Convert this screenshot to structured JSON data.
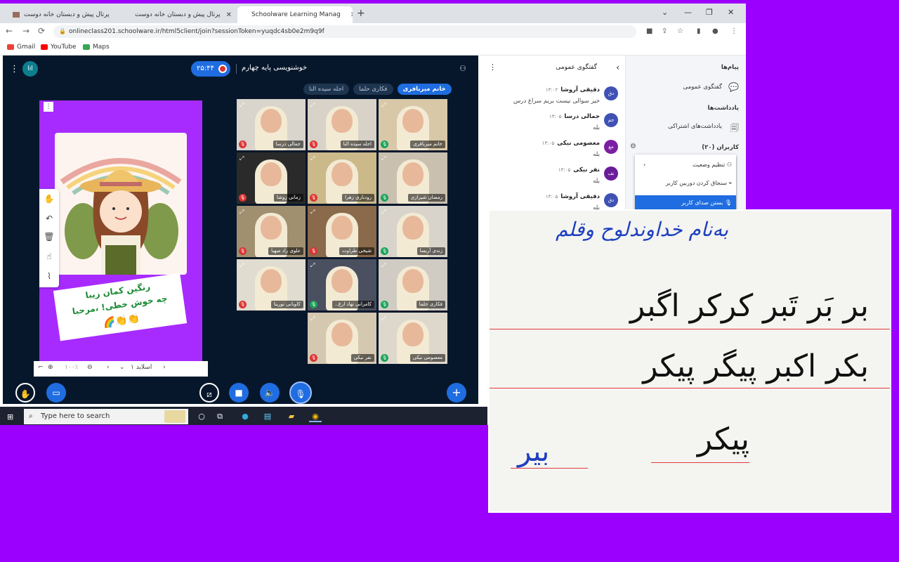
{
  "tabs": [
    {
      "title": "پرتال پیش و دبستان خانه دوست"
    },
    {
      "title": "پرتال پیش و دبستان خانه دوست"
    },
    {
      "title": "Schoolware Learning Manag"
    }
  ],
  "address": {
    "url": "onlineclass201.schoolware.ir/html5client/join?sessionToken=yuqdc4sb0e2m9q9f"
  },
  "bookmarks": [
    {
      "label": "Gmail",
      "color": "#ea4335"
    },
    {
      "label": "YouTube",
      "color": "#ff0000"
    },
    {
      "label": "Maps",
      "color": "#34a853"
    }
  ],
  "conference": {
    "timer": "۲۵:۴۴",
    "session_title": "خوشنویسی پایه چهارم",
    "talkers": [
      {
        "name": "خانم میربافری",
        "speaking": true
      },
      {
        "name": "فکاری حلما",
        "speaking": false
      },
      {
        "name": "اجله سیده النا",
        "speaking": false
      }
    ]
  },
  "slide": {
    "banner_lines": [
      "رنگین کمان زیبا",
      "چه خوش خطی! ،مرحبا"
    ],
    "nav": {
      "page": "اسلاید ۱",
      "zoom": "۱۰۰٪"
    }
  },
  "participants": [
    {
      "name": "خانم میربافری",
      "mic": "on",
      "bg": "#d9c8a8"
    },
    {
      "name": "اجله سیده النا",
      "mic": "off",
      "bg": "#d8d2c8"
    },
    {
      "name": "جمالی درسا",
      "mic": "off",
      "bg": "#d9d4cc"
    },
    {
      "name": "رمضان شیرازی",
      "mic": "on",
      "bg": "#c9c0b0"
    },
    {
      "name": "رودباری زهرا",
      "mic": "off",
      "bg": "#cbb98a"
    },
    {
      "name": "زمانی روشا",
      "mic": "off",
      "bg": "#2a2a2a"
    },
    {
      "name": "زندی آریسا",
      "mic": "on",
      "bg": "#d8d4cc"
    },
    {
      "name": "شیخی طراوت",
      "mic": "off",
      "bg": "#8a6a4a"
    },
    {
      "name": "علوی راد صهبا",
      "mic": "off",
      "bg": "#a09070"
    },
    {
      "name": "فکاری حلما",
      "mic": "on",
      "bg": "#d0ccc4"
    },
    {
      "name": "کامرانی نهاد ارغ..",
      "mic": "on",
      "bg": "#4a5060"
    },
    {
      "name": "کاویانی نورینا",
      "mic": "off",
      "bg": "#e0dcd0"
    },
    {
      "name": "معصومی نیکی",
      "mic": "on",
      "bg": "#ded8cc"
    },
    {
      "name": "نفر نیکی",
      "mic": "off",
      "bg": "#d4c8b0"
    }
  ],
  "chat": {
    "title": "گفتگوی عمومی",
    "messages": [
      {
        "initials": "دق",
        "name": "دقیقی آروشا",
        "time": "۱۳:۰۲",
        "text": "خیر سوالی نیست بریم سراغ درس",
        "color": "#3f51b5"
      },
      {
        "initials": "جم",
        "name": "جمالی درسا",
        "time": "۱۳:۰۵",
        "text": "بله",
        "color": "#3f51b5"
      },
      {
        "initials": "مع",
        "name": "معصومی نیکی",
        "time": "۱۳:۰۵",
        "text": "بله",
        "color": "#7b1fa2"
      },
      {
        "initials": "نف",
        "name": "نفر نیکی",
        "time": "۱۳:۰۵",
        "text": "بله",
        "color": "#6a1b9a"
      },
      {
        "initials": "دق",
        "name": "دقیقی آروشا",
        "time": "۱۳:۰۵",
        "text": "بله",
        "color": "#3f51b5"
      }
    ]
  },
  "sidebar": {
    "messages_heading": "پیام‌ها",
    "public_chat": "گفتگوی عمومی",
    "notes_heading": "یادداشت‌ها",
    "shared_notes": "یادداشت‌های اشتراکی",
    "users_heading": "کاربران (۲۰)"
  },
  "context_menu": {
    "items": [
      "تنظیم وضعیت",
      "سنجاق کردن دوربین کاربر",
      "بستن صدای کاربر"
    ]
  },
  "taskbar": {
    "search_placeholder": "Type here to search"
  },
  "sheet": {
    "heading": "به‌نام خداوندلوح وقلم",
    "row1": "بر  بَر  تَبر  کرکر  اگبر",
    "row2": "بکر  اکبر  پیگر  پیکر",
    "row3_left": "بیر",
    "row3_right": "پیکر"
  }
}
